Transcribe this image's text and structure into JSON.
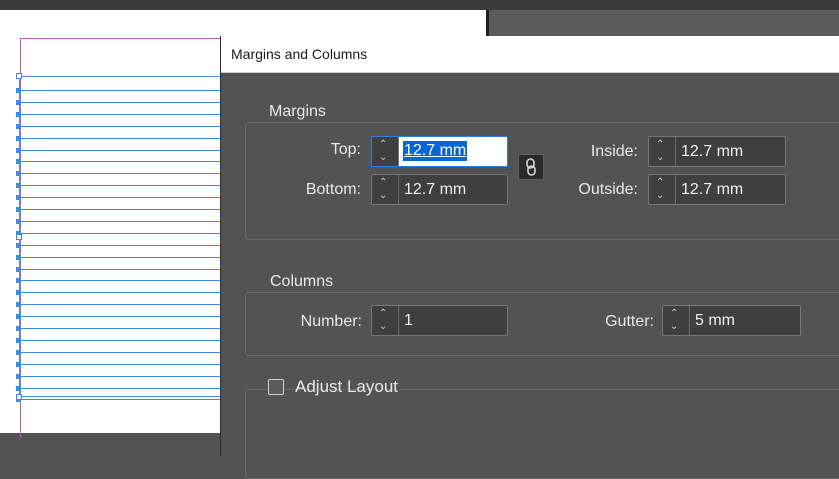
{
  "dialog": {
    "title": "Margins and Columns"
  },
  "margins": {
    "group_label": "Margins",
    "top_label": "Top:",
    "top_value": "12.7 mm",
    "bottom_label": "Bottom:",
    "bottom_value": "12.7 mm",
    "inside_label": "Inside:",
    "inside_value": "12.7 mm",
    "outside_label": "Outside:",
    "outside_value": "12.7 mm",
    "link_icon": "chain-link-icon"
  },
  "columns": {
    "group_label": "Columns",
    "number_label": "Number:",
    "number_value": "1",
    "gutter_label": "Gutter:",
    "gutter_value": "5 mm"
  },
  "adjust_layout": {
    "label": "Adjust Layout",
    "checked": false
  },
  "colors": {
    "selection": "#0a66d6",
    "guide_blue": "#3d8be6",
    "margin_guide": "#c05ac0",
    "dialog_bg": "#535353"
  }
}
